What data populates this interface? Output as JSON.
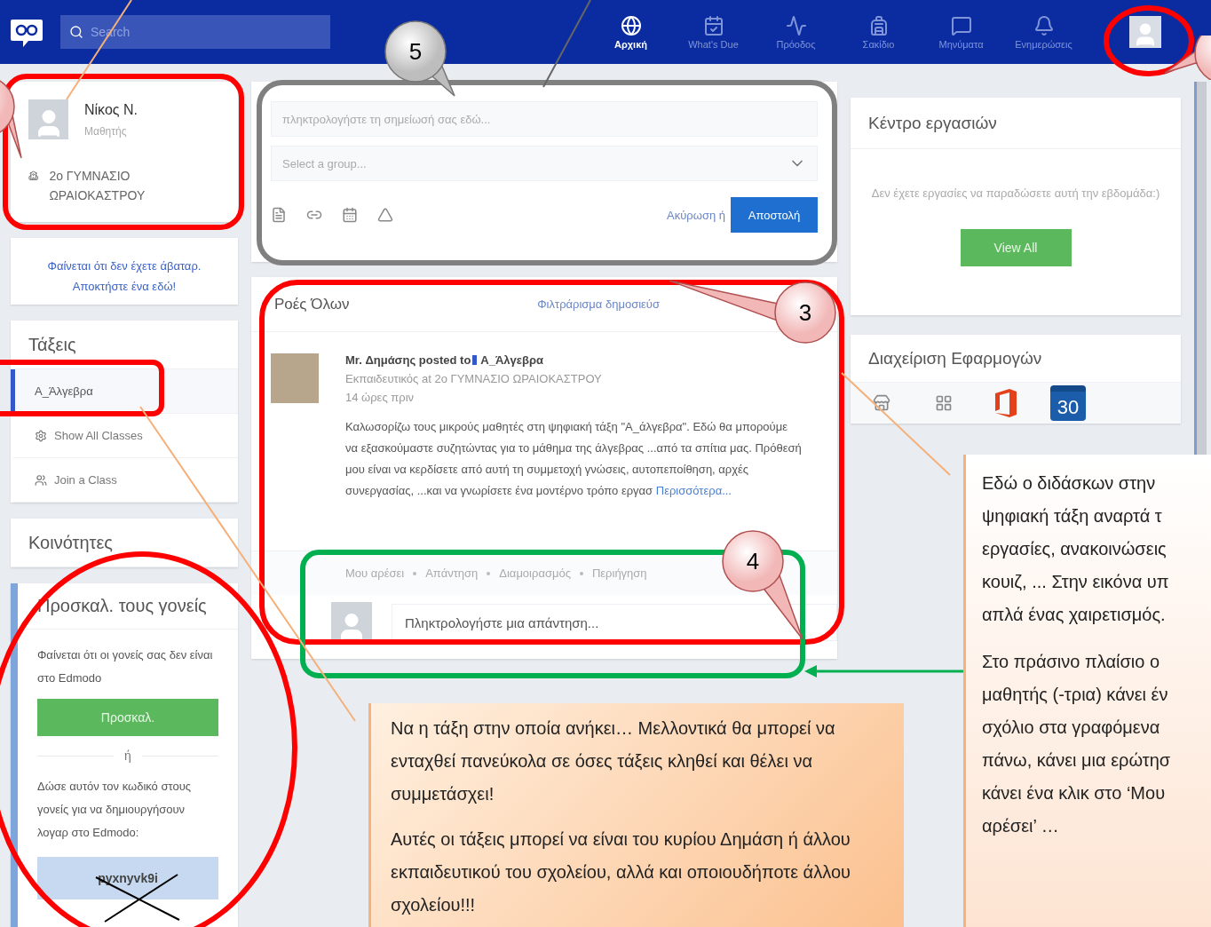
{
  "nav": {
    "search_placeholder": "Search",
    "items": [
      {
        "label": "Αρχική",
        "selected": true
      },
      {
        "label": "What's Due",
        "selected": false
      },
      {
        "label": "Πρόοδος",
        "selected": false
      },
      {
        "label": "Σακίδιο",
        "selected": false
      },
      {
        "label": "Μηνύματα",
        "selected": false
      },
      {
        "label": "Ενημερώσεις",
        "selected": false
      }
    ]
  },
  "profile": {
    "name": "Νίκος Ν.",
    "role": "Μαθητής",
    "school": "2ο ΓΥΜΝΑΣΙΟ ΩΡΑΙΟΚΑΣΤΡΟΥ"
  },
  "avatar_notice": [
    "Φαίνεται ότι δεν έχετε άβαταρ.",
    "Αποκτήστε ένα εδώ!"
  ],
  "classes": {
    "title": "Τάξεις",
    "items": [
      {
        "label": "Α_Άλγεβρα",
        "selected": true,
        "kind": "class"
      },
      {
        "label": "Show All Classes",
        "selected": false,
        "kind": "show_all"
      },
      {
        "label": "Join a Class",
        "selected": false,
        "kind": "join"
      }
    ]
  },
  "communities": {
    "title": "Κοινότητες"
  },
  "parents": {
    "title": "Προσκαλ. τους γονείς",
    "message": "Φαίνεται ότι οι γονείς σας δεν είναι στο Edmodo",
    "button": "Προσκαλ.",
    "or": "ή",
    "code_hint": "Δώσε αυτόν τον κωδικό στους γονείς για να δημιουργήσουν λογαρ στο Edmodo:",
    "code": "pyxnyvk9i"
  },
  "composer": {
    "placeholder": "πληκτρολογήστε τη σημείωσή σας εδώ...",
    "group_placeholder": "Select a group...",
    "cancel": "Ακύρωση ή",
    "send": "Αποστολή"
  },
  "feed": {
    "title": "Ροές Όλων",
    "filter": "Φιλτράρισμα δημοσιεύσ",
    "post": {
      "author": "Mr. Δημάσης",
      "posted_to": "posted to",
      "group": "Α_Άλγεβρα",
      "meta": "Εκπαιδευτικός at 2ο ΓΥΜΝΑΣΙΟ ΩΡΑΙΟΚΑΣΤΡΟΥ",
      "time": "14 ώρες πριν",
      "body": "Καλωσορίζω τους μικρούς μαθητές στη ψηφιακή τάξη \"Α_άλγεβρα\". Εδώ θα μπορούμε να εξασκούμαστε συζητώντας για το μάθημα της άλγεβρας ...από τα σπίτια μας. Πρόθεσή μου είναι να κερδίσετε από αυτή τη συμμετοχή γνώσεις, αυτοπεποίθηση, αρχές συνεργασίας, ...και να γνωρίσετε ένα μοντέρνο τρόπο εργασ",
      "more": "Περισσότερα..."
    },
    "actions": [
      "Μου αρέσει",
      "Απάντηση",
      "Διαμοιρασμός",
      "Περιήγηση"
    ],
    "reply_placeholder": "Πληκτρολογήστε μια απάντηση..."
  },
  "tasks": {
    "title": "Κέντρο εργασιών",
    "message": "Δεν έχετε εργασίες να παραδώσετε αυτή την εβδομάδα:)",
    "button": "View All"
  },
  "apps": {
    "title": "Διαχείριση Εφαρμογών",
    "calendar_day": "30"
  },
  "callouts": [
    "5",
    "3",
    "4"
  ],
  "notes": [
    {
      "paragraphs": [
        [
          "Να η τάξη στην οποία ανήκει…  Μελλοντικά θα μπορεί να ενταχθεί πανεύκολα σε όσες τάξεις κληθεί και θέλει να συμμετάσχει!"
        ],
        [
          "Αυτές οι τάξεις μπορεί να είναι του κυρίου Δημάση ή άλλου εκπαιδευτικού του σχολείου, αλλά και οποιουδήποτε άλλου σχολείου!!!"
        ]
      ]
    },
    {
      "paragraphs": [
        [
          "Εδώ ο διδάσκων στην",
          "ψηφιακή τάξη αναρτά τ",
          "εργασίες, ανακοινώσεις",
          "κουιζ, ... Στην εικόνα υπ",
          "απλά ένας χαιρετισμός."
        ],
        [
          "Στο πράσινο πλαίσιο ο",
          "μαθητής (-τρια) κάνει έν",
          "σχόλιο  στα γραφόμενα",
          "πάνω, κάνει μια ερώτησ",
          "κάνει ένα κλικ στο ‘Μου",
          "αρέσει’ …"
        ]
      ]
    }
  ]
}
